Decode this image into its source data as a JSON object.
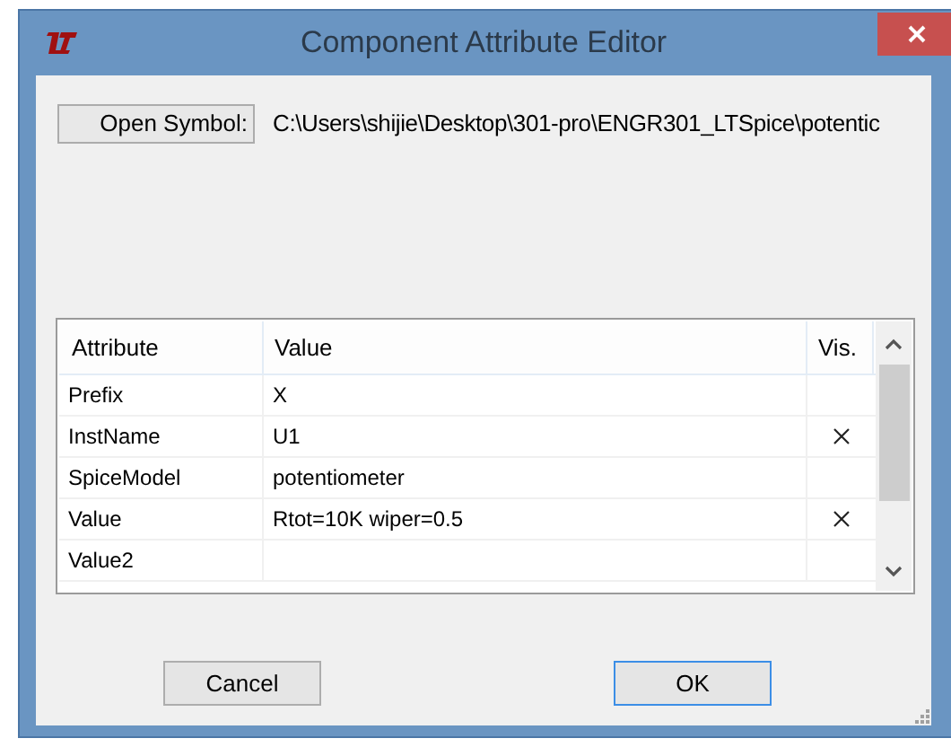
{
  "window": {
    "title": "Component Attribute Editor"
  },
  "open_symbol_button": "Open Symbol:",
  "symbol_path": "C:\\Users\\shijie\\Desktop\\301-pro\\ENGR301_LTSpice\\potentic",
  "table": {
    "columns": [
      "Attribute",
      "Value",
      "Vis."
    ],
    "rows": [
      {
        "attribute": "Prefix",
        "value": "X",
        "visible": false
      },
      {
        "attribute": "InstName",
        "value": "U1",
        "visible": true
      },
      {
        "attribute": "SpiceModel",
        "value": "potentiometer",
        "visible": false
      },
      {
        "attribute": "Value",
        "value": "Rtot=10K wiper=0.5",
        "visible": true
      },
      {
        "attribute": "Value2",
        "visible": false
      }
    ]
  },
  "buttons": [
    {
      "label": "Cancel",
      "selected": false
    },
    {
      "label": "OK",
      "selected": true
    }
  ]
}
